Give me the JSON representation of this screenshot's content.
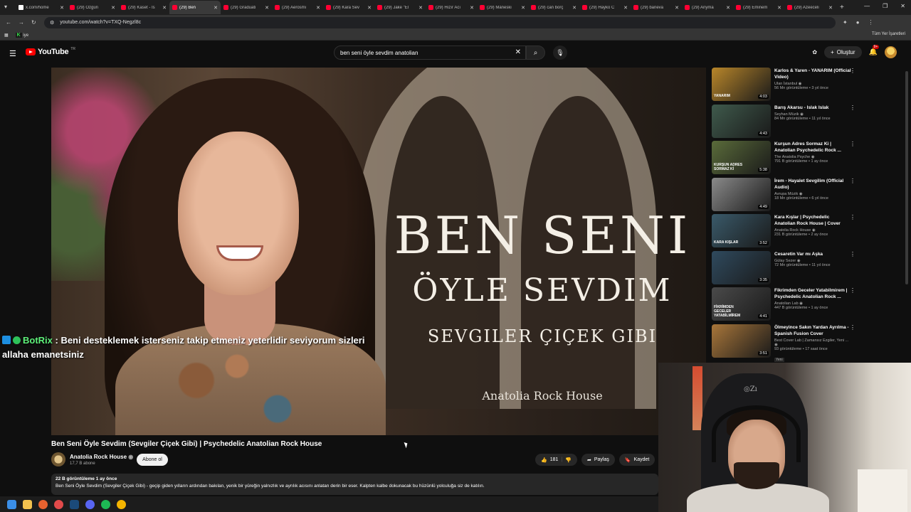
{
  "browser": {
    "tabs": [
      {
        "title": "x.com/home",
        "type": "x"
      },
      {
        "title": "(29) Özgün",
        "type": "yt"
      },
      {
        "title": "(29) Kaset - Is",
        "type": "yt"
      },
      {
        "title": "(29) Ben",
        "type": "yt",
        "active": true
      },
      {
        "title": "(29) Graduati",
        "type": "yt"
      },
      {
        "title": "(29) Aerosmi",
        "type": "yt"
      },
      {
        "title": "(29) Kara Sev",
        "type": "yt"
      },
      {
        "title": "(29) Jake \"El",
        "type": "yt"
      },
      {
        "title": "(29) Hızır Acı",
        "type": "yt"
      },
      {
        "title": "(29) Mäneski",
        "type": "yt"
      },
      {
        "title": "(29) can borç",
        "type": "yt"
      },
      {
        "title": "(29) Hayko C",
        "type": "yt"
      },
      {
        "title": "(29) baneva",
        "type": "yt"
      },
      {
        "title": "(29) Anyma",
        "type": "yt"
      },
      {
        "title": "(29) Eminem",
        "type": "yt"
      },
      {
        "title": "(29) Azeeceli",
        "type": "yt"
      }
    ],
    "url": "youtube.com/watch?v=TXQ-Negzl8c",
    "bookmark_kick": "K",
    "bookmark_label": "iye",
    "all_bookmarks": "Tüm Yer İşaretleri"
  },
  "youtube": {
    "logo_text": "YouTube",
    "logo_region": "TR",
    "search_query": "ben seni öyle sevdim anatolian",
    "create_label": "Oluştur",
    "notif_count": "9+"
  },
  "video": {
    "overlay_line1": "BEN SENI",
    "overlay_line2": "ÖYLE SEVDIM",
    "overlay_line3": "SEVGILER ÇIÇEK GIBI",
    "overlay_channel": "Anatolia Rock House",
    "title": "Ben Seni Öyle Sevdim (Sevgiler Çiçek Gibi) | Psychedelic Anatolian Rock House",
    "channel": "Anatolia Rock House",
    "subscribers": "17,7 B abone",
    "subscribe_label": "Abone ol",
    "likes": "181",
    "share_label": "Paylaş",
    "save_label": "Kaydet",
    "views_meta": "22 B görüntüleme  1 ay önce",
    "description": "Ben Seni Öyle Sevdim (Sevgiler Çiçek Gibi) - geçip giden yılların ardından bakılan, yenik bir yüreğin yalnızlık ve ayrılık acısını anlatan derin bir eser. Kalpten kalbe dokunacak bu hüzünlü yolculuğa siz de katılın."
  },
  "chat": {
    "user": "BotRix",
    "message": " : Beni desteklemek isterseniz takip etmeniz yeterlidir seviyorum sizleri allaha emanetsiniz"
  },
  "recommendations": [
    {
      "title": "Karlos & Yaren - YANARIM (Official Video)",
      "channel": "Ulan İstanbul",
      "meta": "56 Mn görüntüleme • 3 yıl önce",
      "duration": "4:03",
      "thumb": "#b8862a",
      "thumb_text": "YANARIM"
    },
    {
      "title": "Barış Akarsu - Islak Islak",
      "channel": "Seyhan Müzik",
      "meta": "84 Mn görüntüleme • 11 yıl önce",
      "duration": "4:43",
      "thumb": "#3f5a4c",
      "thumb_text": ""
    },
    {
      "title": "Kurşun Adres Sormaz Ki | Anatolian Psychedelic Rock ...",
      "channel": "The Anatolia Psyche",
      "meta": "791 B görüntüleme • 1 ay önce",
      "duration": "5:38",
      "thumb": "#5a6b3a",
      "thumb_text": "KURŞUN ADRES SORMAZ Kİ"
    },
    {
      "title": "İrem - Hayalet Sevgilim (Official Audio)",
      "channel": "Avrupa Müzik",
      "meta": "18 Mn görüntüleme • 6 yıl önce",
      "duration": "4:49",
      "thumb": "#8a8a8a",
      "thumb_text": ""
    },
    {
      "title": "Kara Kışlar | Psychedelic Anatolian Rock House | Cover",
      "channel": "Anatolia Rock House",
      "meta": "231 B görüntüleme • 2 ay önce",
      "duration": "3:52",
      "thumb": "#3a5a6a",
      "thumb_text": "KARA KIŞLAR"
    },
    {
      "title": "Cesaretin Var mı Aşka",
      "channel": "Gülay Sezer",
      "meta": "72 Mn görüntüleme • 11 yıl önce",
      "duration": "3:35",
      "thumb": "#2f4a5e",
      "thumb_text": ""
    },
    {
      "title": "Fikrimden Geceler Yatabilmirem | Psychedelic Anatolian Rock ...",
      "channel": "Anatolian Lab",
      "meta": "447 B görüntüleme • 1 ay önce",
      "duration": "4:41",
      "thumb": "#4a4a4a",
      "thumb_text": "FİKRİMDEN GECELER YATABİLMİREM"
    },
    {
      "title": "Ölmeyince Sakın Yardan Ayrılma - Spanish Fusion Cover",
      "channel": "Best Cover Lab | Zamansız Ezgiler, Yeni ...",
      "meta": "93 görüntüleme • 17 saat önce",
      "duration": "3:51",
      "thumb": "#a8763a",
      "thumb_text": "",
      "new": "Yeni"
    }
  ]
}
